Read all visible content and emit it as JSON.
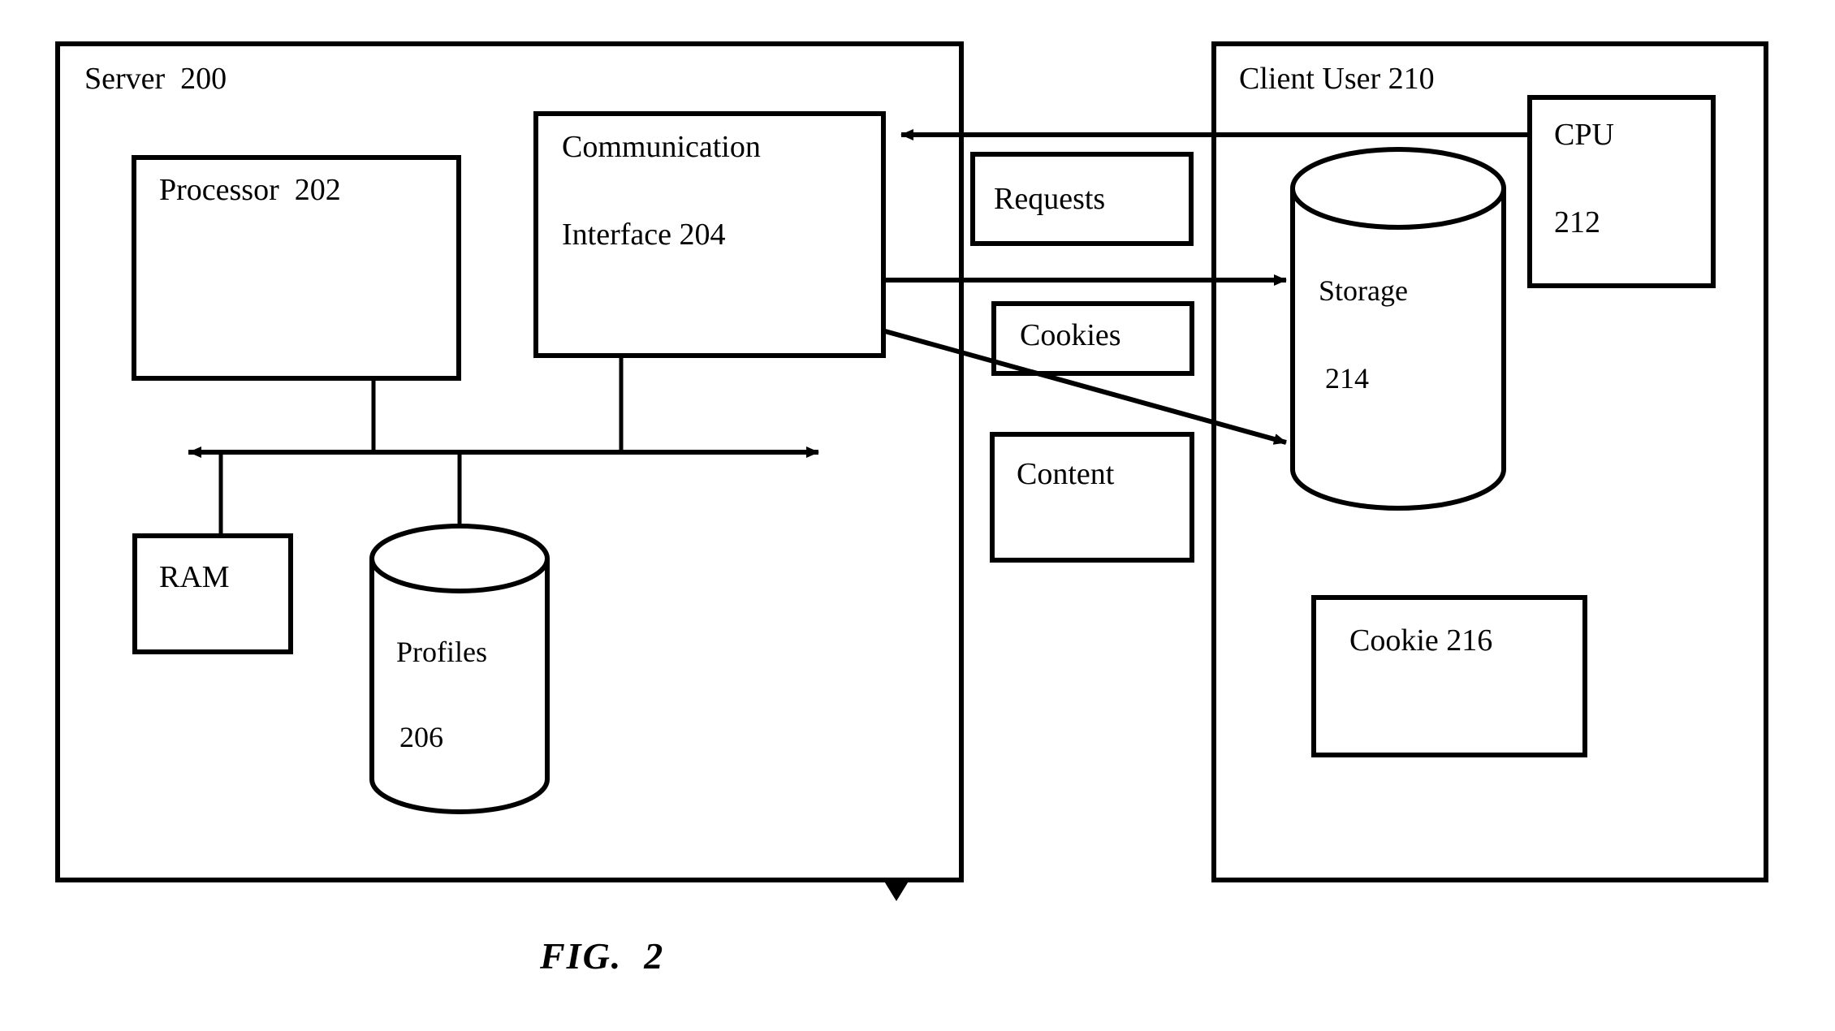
{
  "figure": {
    "caption": "FIG.  2",
    "background_color": "#ffffff",
    "stroke_color": "#000000"
  },
  "server_panel": {
    "name": "server-panel",
    "title": "Server  200",
    "boxes": [
      {
        "id": "processor",
        "label_line1": "Processor  202"
      },
      {
        "id": "communication-interface",
        "label_line1": "Communication",
        "label_line2": "Interface 204"
      },
      {
        "id": "ram",
        "label_line1": "RAM"
      }
    ],
    "cylinders": [
      {
        "id": "profiles",
        "label_line1": "Profiles",
        "label_line2": "206"
      }
    ]
  },
  "channel_labels": {
    "name": "channel-labels",
    "items": [
      {
        "id": "requests",
        "label": "Requests"
      },
      {
        "id": "cookies",
        "label": "Cookies"
      },
      {
        "id": "content",
        "label": "Content"
      }
    ]
  },
  "client_panel": {
    "name": "client-panel",
    "title": "Client User 210",
    "boxes": [
      {
        "id": "cpu",
        "label_line1": "CPU",
        "label_line2": "212"
      },
      {
        "id": "cookie",
        "label_line1": "Cookie 216"
      }
    ],
    "cylinders": [
      {
        "id": "storage",
        "label_line1": "Storage",
        "label_line2": "214"
      }
    ]
  }
}
